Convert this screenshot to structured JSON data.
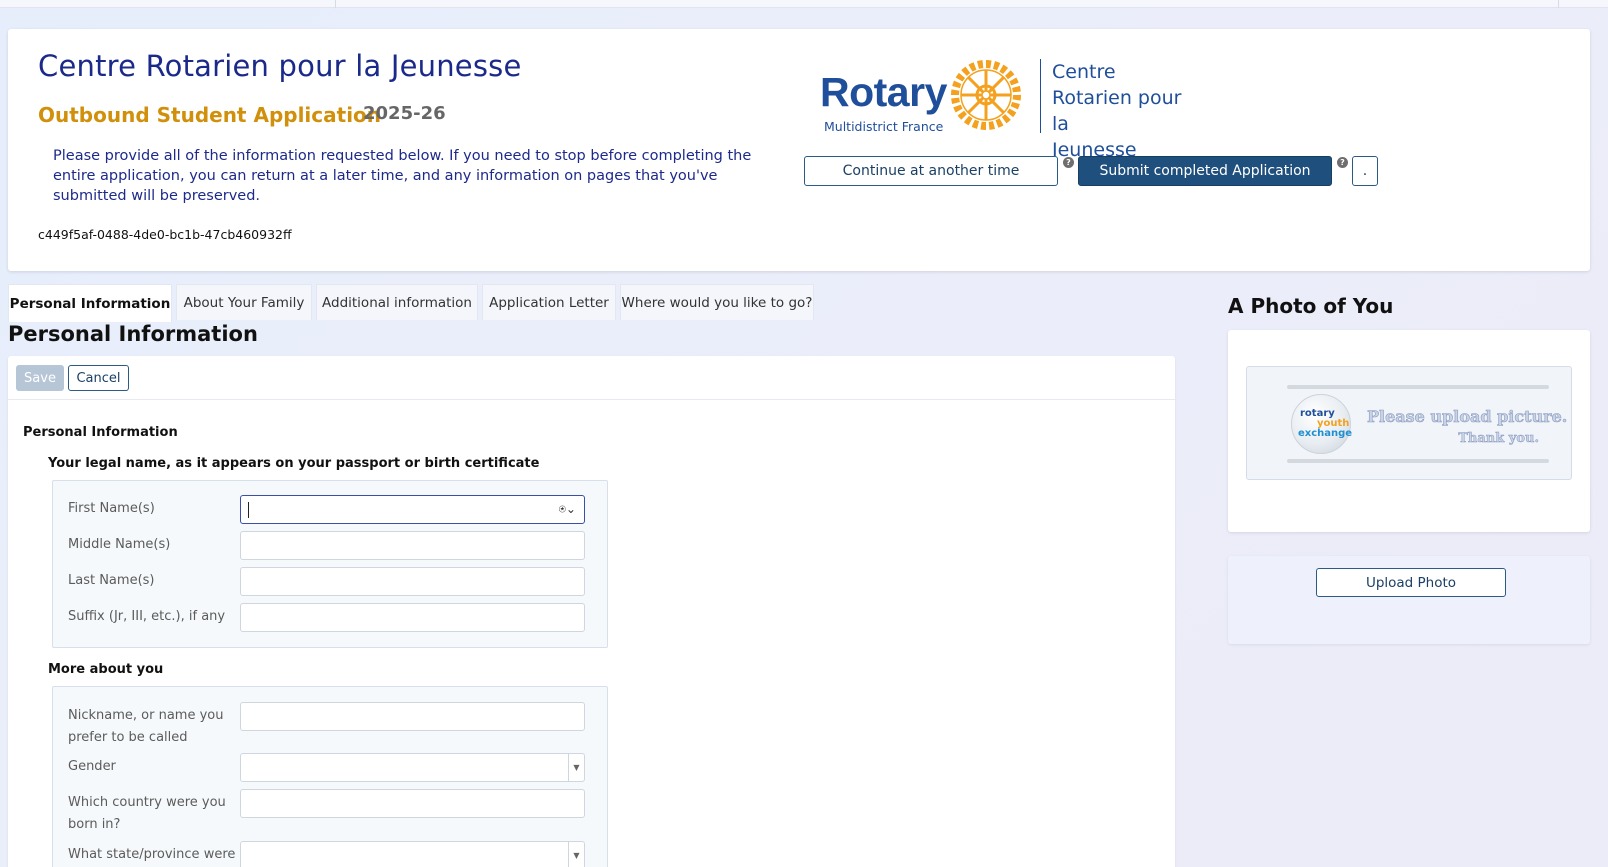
{
  "header": {
    "org_title": "Centre Rotarien pour la Jeunesse",
    "app_title": "Outbound Student Application",
    "app_year": "2025-26",
    "instructions": "Please provide all of the information requested below. If you need to stop before completing the entire application, you can return at a later time, and any information on pages that you've submitted will be preserved.",
    "app_id": "c449f5af-0488-4de0-bc1b-47cb460932ff",
    "continue_label": "Continue at another time",
    "submit_label": "Submit completed Application",
    "dot_label": ".",
    "help_glyph": "?"
  },
  "logo": {
    "rotary": "Rotary",
    "subtitle": "Multidistrict France",
    "centre_lines": [
      "Centre",
      "Rotarien pour la",
      "Jeunesse"
    ],
    "brand_blue": "#1f4e9a",
    "wheel_color": "#f3a11e"
  },
  "tabs": [
    {
      "label": "Personal Information",
      "active": true
    },
    {
      "label": "About Your Family",
      "active": false
    },
    {
      "label": "Additional information",
      "active": false
    },
    {
      "label": "Application Letter",
      "active": false
    },
    {
      "label": "Where would you like to go?",
      "active": false
    }
  ],
  "section_title": "Personal Information",
  "form": {
    "save_label": "Save",
    "cancel_label": "Cancel",
    "group_title": "Personal Information",
    "legal_name_title": "Your legal name, as it appears on your passport or birth certificate",
    "legal_fields": [
      {
        "label": "First Name(s)",
        "value": ""
      },
      {
        "label": "Middle Name(s)",
        "value": ""
      },
      {
        "label": "Last Name(s)",
        "value": ""
      },
      {
        "label": "Suffix (Jr, III, etc.), if any",
        "value": ""
      }
    ],
    "more_title": "More about you",
    "more_fields": [
      {
        "label": "Nickname, or name you prefer to be called",
        "value": ""
      },
      {
        "label": "Gender",
        "value": ""
      },
      {
        "label": "Which country were you born in?",
        "value": ""
      },
      {
        "label": "What state/province were",
        "value": ""
      }
    ],
    "select_arrow": "▼",
    "autofill_glyph": "⍟⌄"
  },
  "photo": {
    "title": "A Photo of You",
    "placeholder_line1": "Please upload picture.",
    "placeholder_line2": "Thank you.",
    "globe_words": [
      "rotary",
      "youth",
      "exchange"
    ],
    "upload_label": "Upload Photo"
  }
}
